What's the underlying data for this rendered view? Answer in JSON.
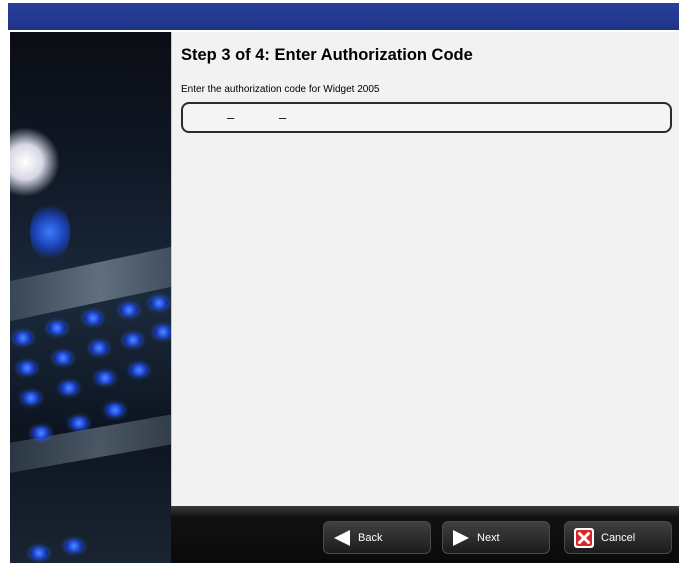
{
  "wizard": {
    "step_title": "Step 3 of 4: Enter Authorization Code",
    "instruction": "Enter the authorization code for Widget 2005",
    "code_field": {
      "separator_1": "–",
      "separator_2": "–"
    }
  },
  "buttons": {
    "back": {
      "label": "Back",
      "icon": "back-arrow-icon"
    },
    "next": {
      "label": "Next",
      "icon": "next-arrow-icon"
    },
    "cancel": {
      "label": "Cancel",
      "icon": "close-icon",
      "icon_color": "#d8262a"
    }
  },
  "colors": {
    "titlebar": "#2a3f9a",
    "content_bg": "#f2f2f2",
    "footer_bg": "#111111"
  }
}
